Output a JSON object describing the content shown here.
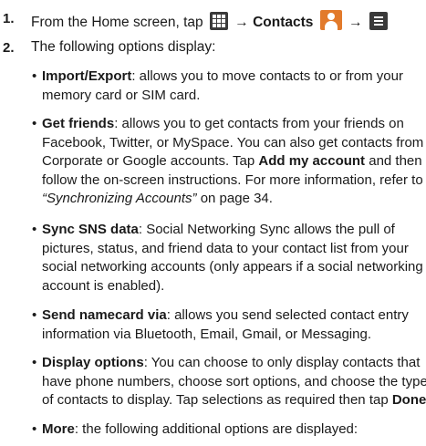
{
  "steps": [
    {
      "num": "1.",
      "text_before": "From the Home screen, tap",
      "arrow1": "→",
      "contacts_label": "Contacts",
      "arrow2": "→"
    },
    {
      "num": "2.",
      "text": "The following options display:"
    }
  ],
  "options": [
    {
      "term": "Import/Export",
      "lines": [
        ": allows you to move contacts to or from your",
        "memory card or SIM card."
      ]
    },
    {
      "term": "Get friends",
      "lines": [
        ": allows you to get contacts from your friends on",
        "Facebook, Twitter, or MySpace. You can also get contacts from",
        "Corporate or Google accounts. Tap "
      ],
      "bold_inline": "Add my account",
      "after_bold": " and then",
      "lines2": [
        "follow the on-screen instructions. For more information, refer to"
      ],
      "ref_italic": "“Synchronizing Accounts”",
      "ref_tail": " on page 34."
    },
    {
      "term": "Sync SNS data",
      "lines": [
        ": Social Networking Sync allows the pull of",
        "pictures, status, and friend data to your contact list from  your",
        "social networking accounts (only appears if a social networking",
        "account is enabled)."
      ]
    },
    {
      "term": "Send namecard via",
      "lines": [
        ": allows you send selected contact entry",
        "information via Bluetooth, Email, Gmail, or Messaging."
      ]
    },
    {
      "term": "Display options",
      "lines": [
        ": You can choose to only display contacts that",
        "have phone numbers, choose sort options, and choose the type",
        "of contacts to display. Tap selections as required then tap "
      ],
      "bold_tail": "Done",
      "tail": "."
    },
    {
      "term": "More",
      "lines": [
        ": the following additional options are displayed:"
      ]
    }
  ],
  "bullet_char": "•",
  "icons": {
    "apps": "apps-grid-icon",
    "contacts": "contacts-icon",
    "menu": "menu-icon"
  }
}
